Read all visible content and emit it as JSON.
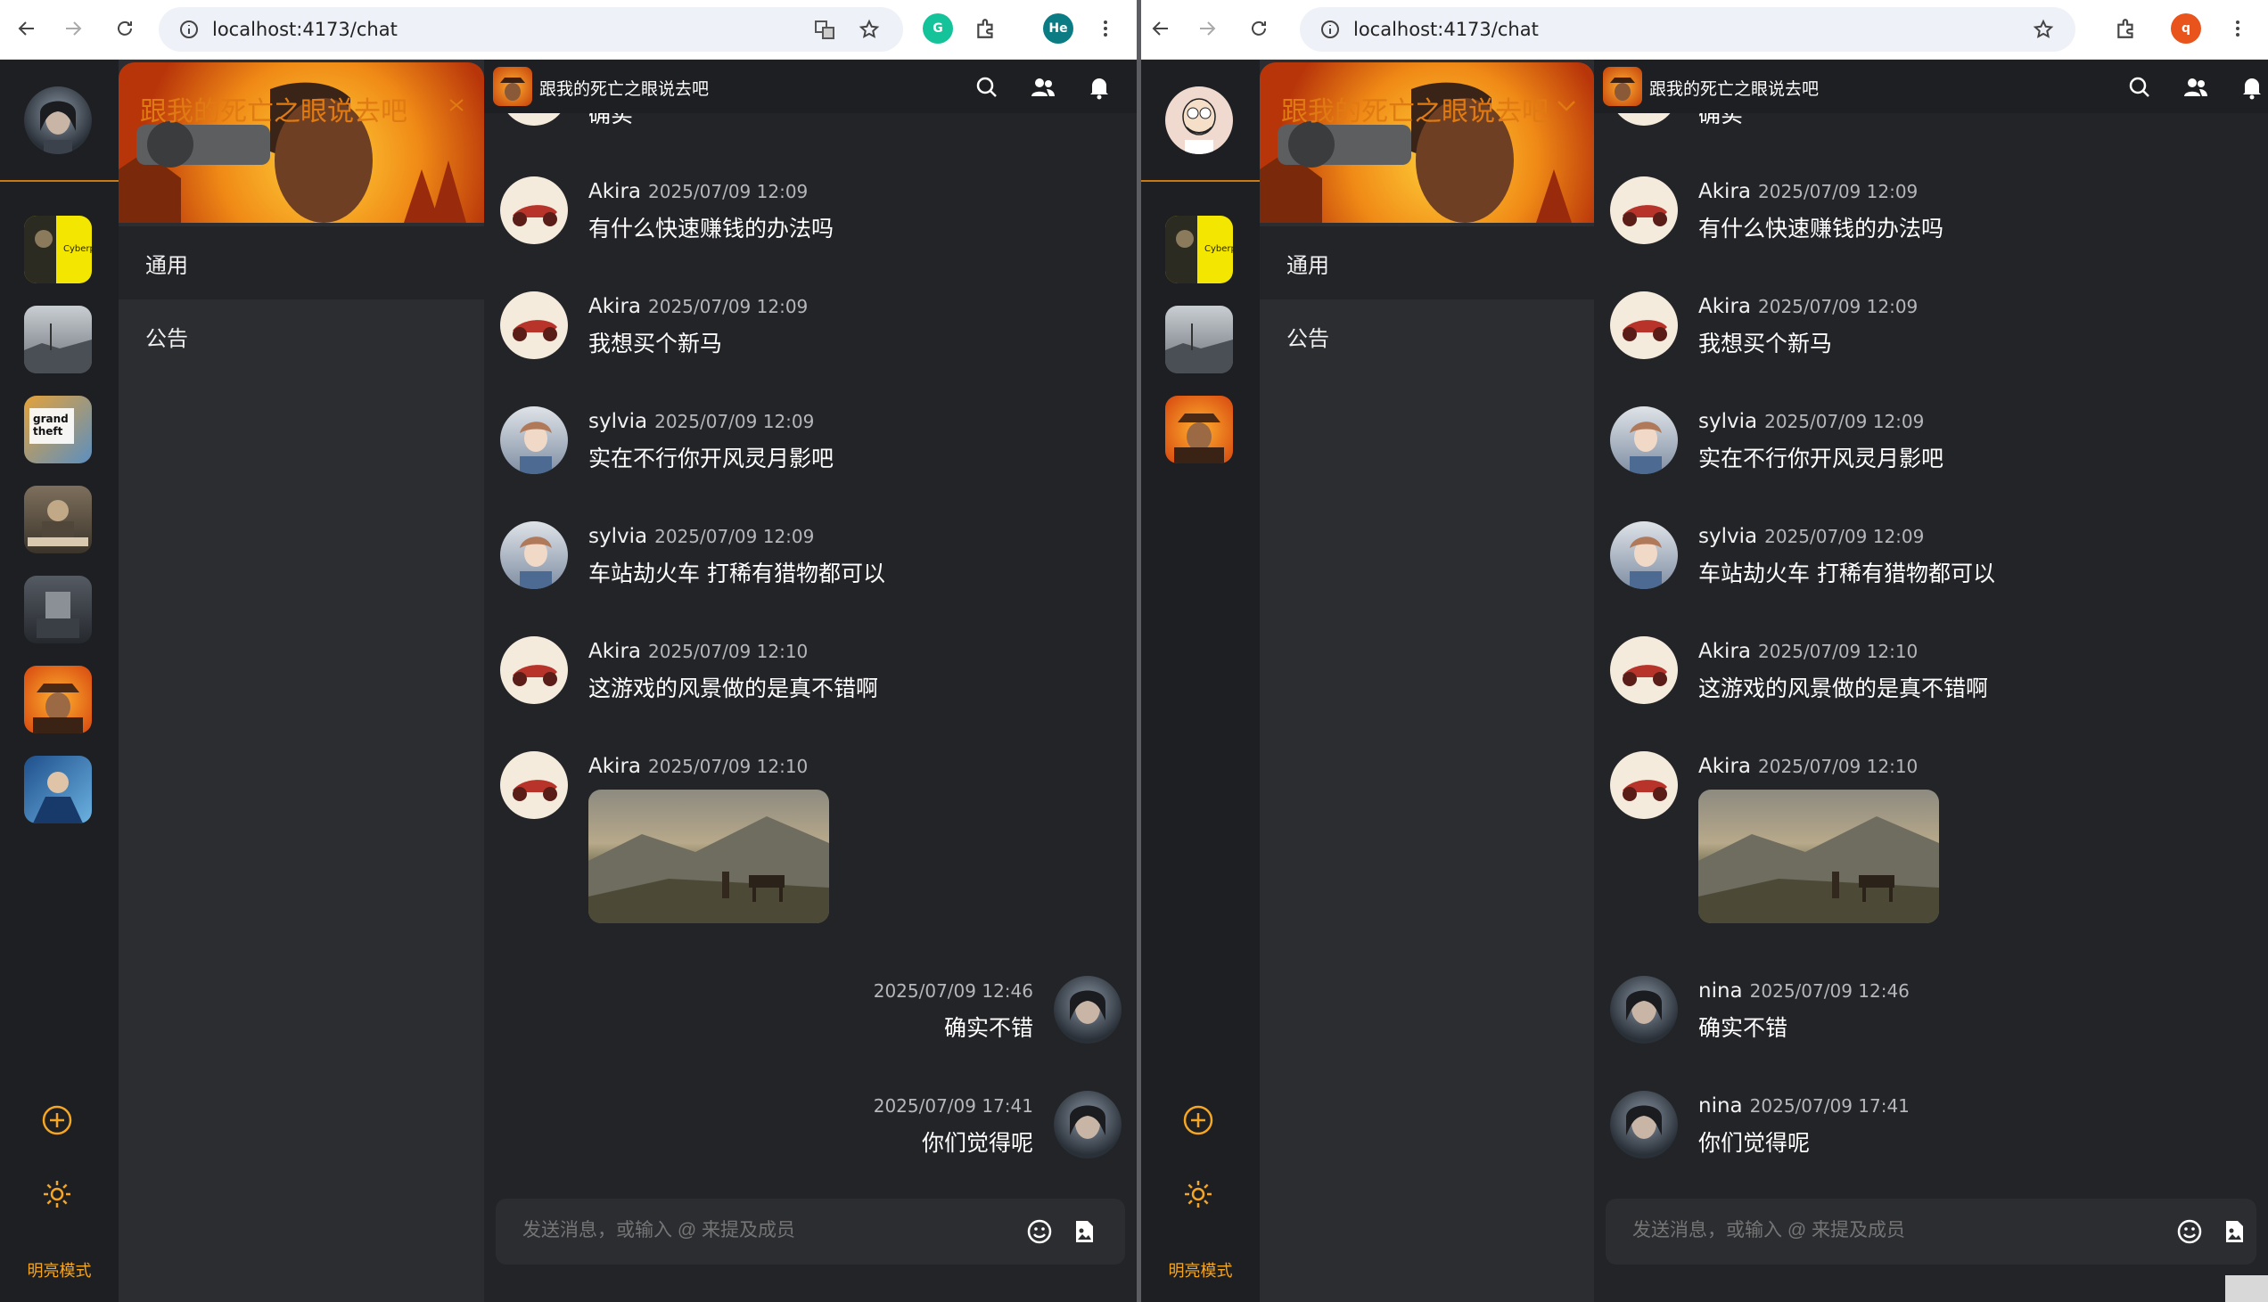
{
  "left": {
    "url": "localhost:4173/chat",
    "profile_initials": "He",
    "server_title": "跟我的死亡之眼说去吧",
    "channels": [
      "通用",
      "公告"
    ],
    "chat_title": "跟我的死亡之眼说去吧",
    "mode_label": "明亮模式",
    "input_placeholder": "发送消息，或输入 @ 来提及成员",
    "partial_text": "确实",
    "messages": [
      {
        "name": "Akira",
        "time": "2025/07/09 12:09",
        "text": "有什么快速赚钱的办法吗"
      },
      {
        "name": "Akira",
        "time": "2025/07/09 12:09",
        "text": "我想买个新马"
      },
      {
        "name": "sylvia",
        "time": "2025/07/09 12:09",
        "text": "实在不行你开风灵月影吧"
      },
      {
        "name": "sylvia",
        "time": "2025/07/09 12:09",
        "text": "车站劫火车 打稀有猎物都可以"
      },
      {
        "name": "Akira",
        "time": "2025/07/09 12:10",
        "text": "这游戏的风景做的是真不错啊"
      },
      {
        "name": "Akira",
        "time": "2025/07/09 12:10",
        "text": ""
      },
      {
        "name": "",
        "time": "2025/07/09 12:46",
        "text": "确实不错"
      },
      {
        "name": "",
        "time": "2025/07/09 17:41",
        "text": "你们觉得呢"
      }
    ]
  },
  "right": {
    "url": "localhost:4173/chat",
    "profile_initials": "q",
    "server_title": "跟我的死亡之眼说去吧",
    "channels": [
      "通用",
      "公告"
    ],
    "chat_title": "跟我的死亡之眼说去吧",
    "mode_label": "明亮模式",
    "input_placeholder": "发送消息，或输入 @ 来提及成员",
    "partial_text": "确实",
    "messages": [
      {
        "name": "Akira",
        "time": "2025/07/09 12:09",
        "text": "有什么快速赚钱的办法吗"
      },
      {
        "name": "Akira",
        "time": "2025/07/09 12:09",
        "text": "我想买个新马"
      },
      {
        "name": "sylvia",
        "time": "2025/07/09 12:09",
        "text": "实在不行你开风灵月影吧"
      },
      {
        "name": "sylvia",
        "time": "2025/07/09 12:09",
        "text": "车站劫火车 打稀有猎物都可以"
      },
      {
        "name": "Akira",
        "time": "2025/07/09 12:10",
        "text": "这游戏的风景做的是真不错啊"
      },
      {
        "name": "Akira",
        "time": "2025/07/09 12:10",
        "text": ""
      },
      {
        "name": "nina",
        "time": "2025/07/09 12:46",
        "text": "确实不错"
      },
      {
        "name": "nina",
        "time": "2025/07/09 17:41",
        "text": "你们觉得呢"
      }
    ]
  },
  "colors": {
    "accent": "#f5a623",
    "background": "#232428",
    "rail": "#1e1f22",
    "panel": "#2b2d31"
  }
}
